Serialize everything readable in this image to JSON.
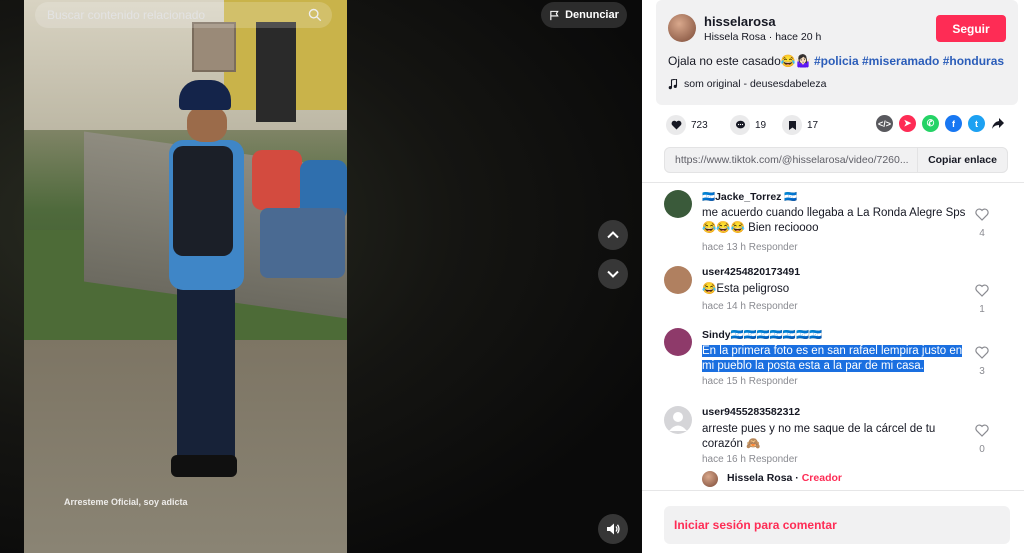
{
  "search": {
    "placeholder": "Buscar contenido relacionado"
  },
  "report": {
    "label": "Denunciar"
  },
  "video": {
    "caption": "Arresteme Oficial, soy adicta"
  },
  "author": {
    "username": "hisselarosa",
    "display_name": "Hissela Rosa",
    "time": "hace 20 h",
    "follow_label": "Seguir"
  },
  "description": {
    "text": "Ojala no este casado😂🤷🏻‍♀️ ",
    "tags": [
      "#policia",
      "#miseramado",
      "#honduras"
    ]
  },
  "music": {
    "label": "som original - deusesdabeleza"
  },
  "stats": {
    "likes": "723",
    "comments": "19",
    "saves": "17"
  },
  "share_icons": [
    {
      "name": "embed-icon",
      "color": "#59595e",
      "glyph": "</>"
    },
    {
      "name": "send-icon",
      "color": "#fe2c55",
      "glyph": "➤"
    },
    {
      "name": "whatsapp-icon",
      "color": "#25d366",
      "glyph": "✆"
    },
    {
      "name": "facebook-icon",
      "color": "#1877f2",
      "glyph": "f"
    },
    {
      "name": "twitter-icon",
      "color": "#1da1f2",
      "glyph": "t"
    }
  ],
  "link": {
    "url": "https://www.tiktok.com/@hisselarosa/video/7260...",
    "copy_label": "Copiar enlace"
  },
  "comments": [
    {
      "user": "🇭🇳Jacke_Torrez 🇭🇳",
      "text": "me acuerdo cuando llegaba a La Ronda Alegre Sps 😂😂😂 Bien recioooo",
      "time": "hace 13 h",
      "reply_label": "Responder",
      "likes": "4",
      "avatar_color": "#3a5a3a"
    },
    {
      "user": "user4254820173491",
      "text": "😂Esta peligroso",
      "time": "hace 14 h",
      "reply_label": "Responder",
      "likes": "1",
      "avatar_color": "#b08060"
    },
    {
      "user": "Sindy🇭🇳🇭🇳🇭🇳🇭🇳🇭🇳🇭🇳🇭🇳",
      "text": "En la primera foto es en san rafael lempira justo en mi pueblo la posta esta a la par de mi casa.",
      "time": "hace 15 h",
      "reply_label": "Responder",
      "likes": "3",
      "avatar_color": "#8e3a6a"
    },
    {
      "user": "user9455283582312",
      "text": "arreste pues y no me saque de la cárcel de tu corazón 🙈",
      "time": "hace 16 h",
      "reply_label": "Responder",
      "likes": "0",
      "avatar_color": "#d5d5d8"
    }
  ],
  "reply_preview": {
    "name": "Hissela Rosa",
    "separator": " · ",
    "badge": "Creador"
  },
  "login": {
    "label": "Iniciar sesión para comentar"
  }
}
